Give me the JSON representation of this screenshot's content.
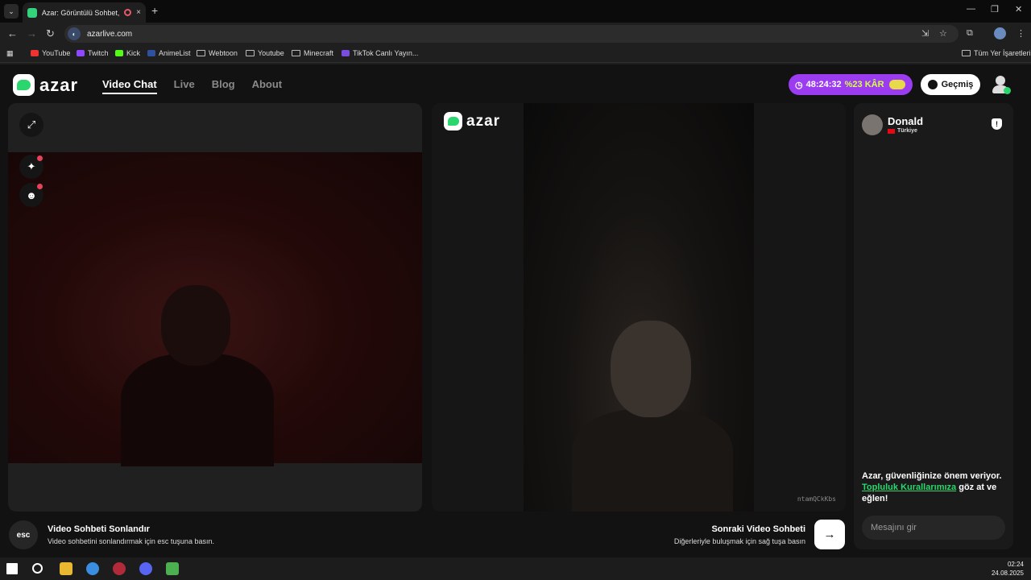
{
  "browser": {
    "tab_title": "Azar: Görüntülü Sohbet, Ar...",
    "tab_close": "×",
    "new_tab": "+",
    "url": "azarlive.com",
    "bookmarks": [
      "YouTube",
      "Twitch",
      "Kick",
      "AnimeList",
      "Webtoon",
      "Youtube",
      "Minecraft",
      "TikTok Canlı Yayın..."
    ],
    "all_bookmarks": "Tüm Yer İşaretleri",
    "icons": [
      "back-icon",
      "forward-icon",
      "reload-icon",
      "install-icon",
      "star-icon",
      "extensions-icon",
      "menu-icon"
    ]
  },
  "header": {
    "logo_text": "azar",
    "nav": [
      "Video Chat",
      "Live",
      "Blog",
      "About"
    ],
    "active_nav": "Video Chat",
    "promo_timer": "48:24:32",
    "promo_discount": "%23 KÂR",
    "history_label": "Geçmiş",
    "colors": {
      "accent": "#2bd66e",
      "promo": "#9b3cf0",
      "promo_text": "#d6ff4a"
    }
  },
  "local_panel": {
    "buttons": [
      "expand-icon",
      "effects-icon",
      "sticker-icon"
    ]
  },
  "remote_panel": {
    "logo_text": "azar",
    "watermark": "ntamQCkKbs"
  },
  "chat": {
    "user_name": "Donald",
    "country": "Türkiye",
    "safety_text_1": "Azar, güvenliğinize önem veriyor.",
    "safety_link": "Topluluk Kurallarımıza",
    "safety_text_2": "göz at ve eğlen!",
    "input_placeholder": "Mesajını gir"
  },
  "footer": {
    "esc_label": "esc",
    "end_title": "Video Sohbeti Sonlandır",
    "end_sub": "Video sohbetini sonlandırmak için esc tuşuna basın.",
    "next_title": "Sonraki Video Sohbeti",
    "next_sub": "Diğerleriyle buluşmak için sağ tuşa basın",
    "next_icon": "→"
  },
  "taskbar": {
    "time": "02:24",
    "date": "24.08.2025"
  }
}
